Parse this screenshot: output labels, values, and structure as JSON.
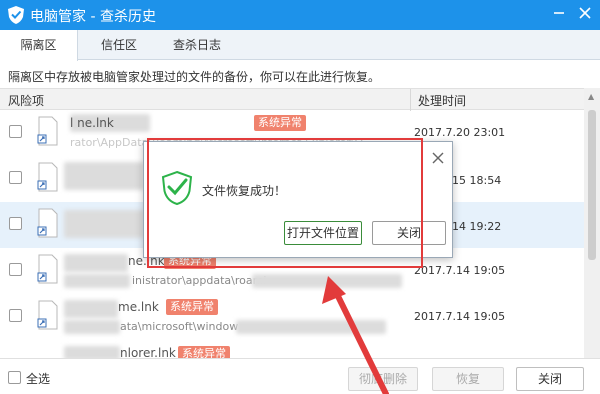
{
  "window": {
    "title": "电脑管家 - 查杀历史",
    "title_icon": "qq-pc-manager-shield-icon",
    "controls": [
      "minimize-icon",
      "close-icon"
    ]
  },
  "tabs": [
    {
      "label": "隔离区",
      "active": true
    },
    {
      "label": "信任区",
      "active": false
    },
    {
      "label": "查杀日志",
      "active": false
    }
  ],
  "description": "隔离区中存放被电脑管家处理过的文件的备份，你可以在此进行恢复。",
  "table": {
    "columns": [
      "风险项",
      "处理时间"
    ],
    "rows": [
      {
        "name": "l                ne.lnk",
        "badge": "系统异常",
        "path": "             rator\\AppData\\Roaming\\Microsoft\\Internet Explorer\\Q",
        "time": "2017.7.20 23:01",
        "selected": false
      },
      {
        "name": "",
        "badge": "",
        "path": "",
        "time": "15 18:54",
        "selected": false
      },
      {
        "name": "",
        "badge": "",
        "path": "",
        "time": "14 19:22",
        "selected": true
      },
      {
        "name": "ne.lnk",
        "badge": "系统异常",
        "path": "inistrator\\appdata\\roami",
        "time": "2017.7.14 19:05",
        "selected": false
      },
      {
        "name": "me.lnk",
        "badge": "系统异常",
        "path": "ata\\microsoft\\window",
        "time": "2017.7.14 19:05",
        "selected": false
      },
      {
        "name": "nlorer.lnk",
        "badge": "系统异常",
        "path": "",
        "time": "",
        "selected": false
      }
    ]
  },
  "footer": {
    "select_all": "全选",
    "delete_label": "彻底删除",
    "restore_label": "恢复",
    "close_label": "关闭"
  },
  "dialog": {
    "message": "文件恢复成功！",
    "open_location_label": "打开文件位置",
    "close_label": "关闭",
    "icon": "green-check-shield-icon",
    "close_icon": "close-x-icon"
  },
  "colors": {
    "titlebar": "#1d92ea",
    "badge": "#f0826d",
    "annotation": "#e23b3b",
    "success": "#2db34a"
  }
}
